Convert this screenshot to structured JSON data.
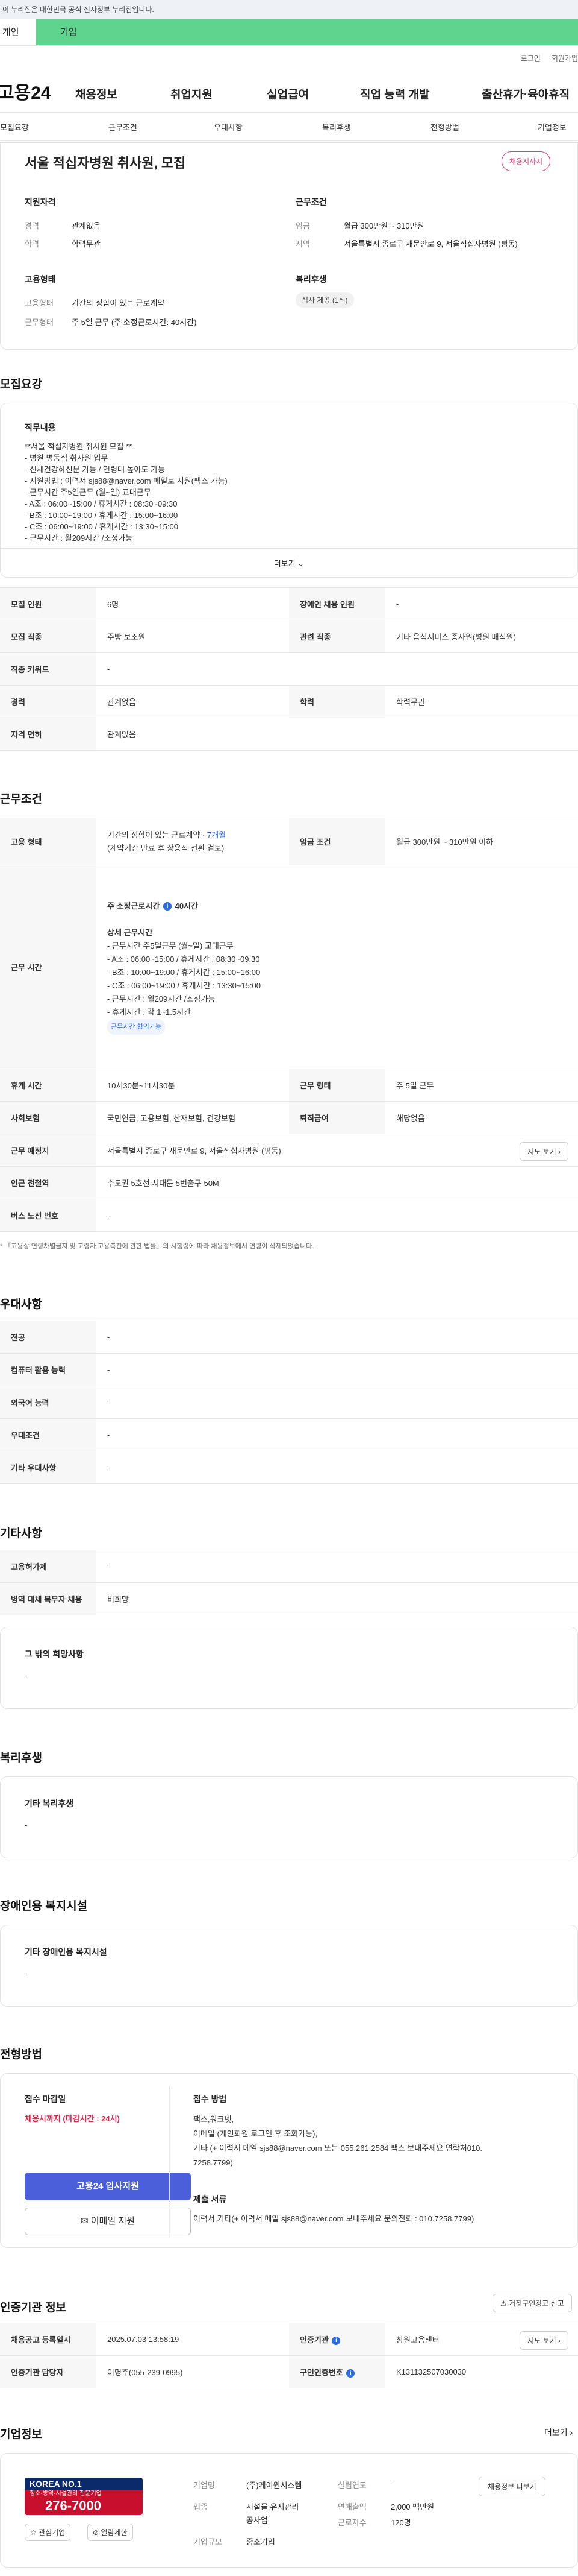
{
  "gov_banner": "이 누리집은 대한민국 공식 전자정부 누리집입니다.",
  "ent_tabs": [
    "개인",
    "기업"
  ],
  "util_links": [
    "로그인",
    "회원가입"
  ],
  "logo": "고용24",
  "gnb": [
    "채용정보",
    "취업지원",
    "실업급여",
    "직업 능력 개발",
    "출산휴가·육아휴직"
  ],
  "snb": [
    "모집요강",
    "근무조건",
    "우대사항",
    "복리후생",
    "전형방법",
    "기업정보"
  ],
  "summary": {
    "title": "서울 적십자병원 취사원, 모집",
    "deadline_badge": "채용시까지",
    "qual_title": "지원자격",
    "career_label": "경력",
    "career_val": "관계없음",
    "edu_label": "학력",
    "edu_val": "학력무관",
    "cond_title": "근무조건",
    "wage_label": "임금",
    "wage_val": "월급 300만원 ~ 310만원",
    "region_label": "지역",
    "region_val": "서울특별시 종로구 새문안로 9, 서울적십자병원 (평동)",
    "emp_title": "고용형태",
    "emptype_label": "고용형태",
    "emptype_val": "기간의 정함이 있는 근로계약",
    "worktype_label": "근무형태",
    "worktype_val": "주 5일 근무 (주 소정근로시간: 40시간)",
    "welfare_title": "복리후생",
    "welfare_tag": "식사 제공 (1식)"
  },
  "recruit": {
    "section_title": "모집요강",
    "duty_title": "직무내용",
    "duty_lines": [
      "**서울 적십자병원 취사원 모집 **",
      "- 병원 병동식 취사원 업무",
      "- 신체건강하신분 가능 / 연령대 높아도 가능",
      "- 지원방법 : 이력서 sjs88@naver.com 메일로 지원(팩스 가능)",
      "- 근무시간 주5일근무 (월~일) 교대근무",
      "- A조 : 06:00~15:00 / 휴게시간 : 08:30~09:30",
      "- B조 : 10:00~19:00 / 휴게시간 : 15:00~16:00",
      "- C조 : 06:00~19:00 / 휴게시간 : 13:30~15:00",
      "- 근무시간 : 월209시간 /조정가능"
    ],
    "more": "더보기",
    "rows": [
      {
        "l1": "모집 인원",
        "v1": "6명",
        "l2": "장애인 채용 인원",
        "v2": "-"
      },
      {
        "l1": "모집 직종",
        "v1": "주방 보조원",
        "l2": "관련 직종",
        "v2": "기타 음식서비스 종사원(병원 배식원)"
      },
      {
        "l1": "직종 키워드",
        "v1": "-"
      },
      {
        "l1": "경력",
        "v1": "관계없음",
        "l2": "학력",
        "v2": "학력무관"
      },
      {
        "l1": "자격 면허",
        "v1": "관계없음"
      }
    ]
  },
  "work": {
    "section_title": "근무조건",
    "emptype_label": "고용 형태",
    "emptype_val": "기간의 정함이 있는 근로계약 · ",
    "emptype_months": "7개월",
    "emptype_note": "(계약기간 만료 후 상용직 전환 검토)",
    "wage_label": "임금 조건",
    "wage_val": "월급 300만원 ~ 310만원 이하",
    "hours_label": "근무 시간",
    "hours_head": "주 소정근로시간",
    "hours_head_val": "40시간",
    "hours_detail_title": "상세 근무시간",
    "hours_lines": [
      "- 근무시간 주5일근무 (월~일) 교대근무",
      "- A조 : 06:00~15:00 / 휴게시간 : 08:30~09:30",
      "- B조 : 10:00~19:00 / 휴게시간 : 15:00~16:00",
      "- C조 : 06:00~19:00 / 휴게시간 : 13:30~15:00",
      "- 근무시간 : 월209시간 /조정가능",
      "- 휴게시간 : 각 1~1.5시간"
    ],
    "hours_tag": "근무시간 협의가능",
    "break_label": "휴게 시간",
    "break_val": "10시30분~11시30분",
    "shift_label": "근무 형태",
    "shift_val": "주 5일 근무",
    "ins_label": "사회보험",
    "ins_val": "국민연금, 고용보험, 산재보험, 건강보험",
    "sev_label": "퇴직급여",
    "sev_val": "해당없음",
    "place_label": "근무 예정지",
    "place_val": "서울특별시 종로구 새문안로 9, 서울적십자병원 (평동)",
    "map_btn": "지도 보기",
    "subway_label": "인근 전철역",
    "subway_val": "수도권 5호선 서대문 5번출구 50M",
    "bus_label": "버스 노선 번호",
    "bus_val": "-",
    "note": "* 「고용상 연령차별금지 및 고령자 고용촉진에 관한 법률」의 시행령에 따라 채용정보에서 연령이 삭제되었습니다."
  },
  "pref": {
    "section_title": "우대사항",
    "rows": [
      {
        "l": "전공",
        "v": "-"
      },
      {
        "l": "컴퓨터 활용 능력",
        "v": "-"
      },
      {
        "l": "외국어 능력",
        "v": "-"
      },
      {
        "l": "우대조건",
        "v": "-"
      },
      {
        "l": "기타 우대사항",
        "v": "-"
      }
    ]
  },
  "etc": {
    "section_title": "기타사항",
    "rows": [
      {
        "l": "고용허가제",
        "v": "-"
      },
      {
        "l": "병역 대체 복무자 채용",
        "v": "비희망"
      }
    ],
    "other_title": "그 밖의 희망사항",
    "other_val": "-"
  },
  "welfare": {
    "section_title": "복리후생",
    "box_title": "기타 복리후생",
    "box_val": "-"
  },
  "disability": {
    "section_title": "장애인용 복지시설",
    "box_title": "기타 장애인용 복지시설",
    "box_val": "-"
  },
  "process": {
    "section_title": "전형방법",
    "deadline_title": "접수 마감일",
    "deadline_val": "채용시까지 (마감시간 : 24시)",
    "apply_btn": "고용24 입사지원",
    "email_btn": "이메일 지원",
    "method_title": "접수 방법",
    "method_lines": [
      "팩스,워크넷,",
      "이메일 (개인회원 로그인 후 조회가능),",
      "기타 (+ 이력서  메일 sjs88@naver.com 또는  055.261.2584 팩스 보내주세요 연락처010.",
      "7258.7799)"
    ],
    "docs_title": "제출 서류",
    "docs_val": "이력서,기타(+ 이력서  메일  sjs88@naver.com  보내주세요   문의전화 : 010.7258.7799)"
  },
  "cert": {
    "section_title": "인증기관 정보",
    "report_btn": "거짓구인광고 신고",
    "rows": [
      {
        "l1": "채용공고 등록일시",
        "v1": "2025.07.03 13:58:19",
        "l2": "인증기관",
        "v2": "창원고용센터",
        "btn": "지도 보기"
      },
      {
        "l1": "인증기관 담당자",
        "v1": "이명주(055-239-0995)",
        "l2": "구인인증번호",
        "v2": "K131132507030030"
      }
    ]
  },
  "company": {
    "section_title": "기업정보",
    "more": "더보기",
    "logo_text": "KOREA NO.1",
    "logo_phone": "276-7000",
    "logo_sub": "청소·방역·시설관리 전문기업",
    "fav_btn": "관심기업",
    "block_btn": "열람제한",
    "name_label": "기업명",
    "name_val": "(주)케이원시스템",
    "ind_label": "업종",
    "ind_val1": "시설물 유지관리",
    "ind_val2": "공사업",
    "scale_label": "기업규모",
    "scale_val": "중소기업",
    "year_label": "설립연도",
    "year_val": "-",
    "sales_label": "연매출액",
    "sales_val": "2,000 백만원",
    "emp_label": "근로자수",
    "emp_val": "120명",
    "jobs_btn": "채용정보 더보기"
  }
}
